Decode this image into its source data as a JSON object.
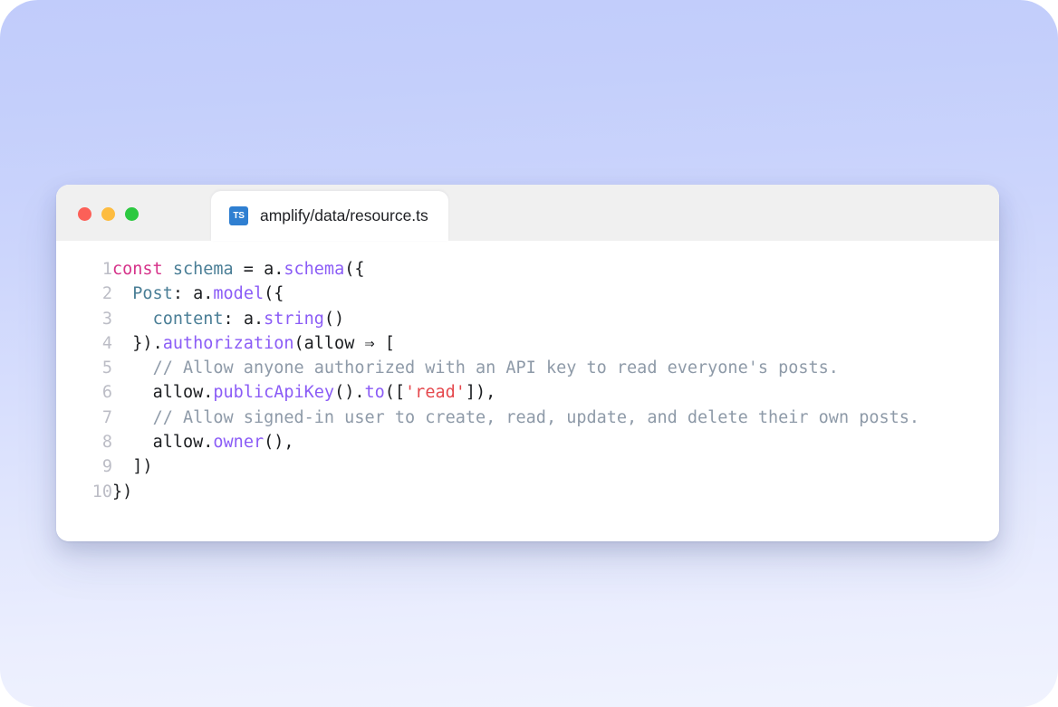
{
  "window": {
    "traffic_lights": [
      {
        "name": "close",
        "color": "#fc6058"
      },
      {
        "name": "minimize",
        "color": "#fdbc40"
      },
      {
        "name": "maximize",
        "color": "#2cc840"
      }
    ],
    "tab": {
      "icon": "typescript-file-icon",
      "icon_text": "TS",
      "label": "amplify/data/resource.ts"
    }
  },
  "editor": {
    "language": "typescript",
    "gutter_numbers": [
      "1",
      "2",
      "3",
      "4",
      "5",
      "6",
      "7",
      "8",
      "9",
      "10"
    ],
    "lines": [
      {
        "number": "1",
        "text": "const schema = a.schema({",
        "tokens": [
          {
            "t": "const",
            "c": "keyword"
          },
          {
            "t": " ",
            "c": "plain"
          },
          {
            "t": "schema",
            "c": "var"
          },
          {
            "t": " = ",
            "c": "plain"
          },
          {
            "t": "a",
            "c": "plain"
          },
          {
            "t": ".",
            "c": "punct"
          },
          {
            "t": "schema",
            "c": "method"
          },
          {
            "t": "({",
            "c": "punct"
          }
        ]
      },
      {
        "number": "2",
        "text": "  Post: a.model({",
        "tokens": [
          {
            "t": "  ",
            "c": "plain"
          },
          {
            "t": "Post",
            "c": "prop"
          },
          {
            "t": ": ",
            "c": "punct"
          },
          {
            "t": "a",
            "c": "plain"
          },
          {
            "t": ".",
            "c": "punct"
          },
          {
            "t": "model",
            "c": "method"
          },
          {
            "t": "({",
            "c": "punct"
          }
        ]
      },
      {
        "number": "3",
        "text": "    content: a.string()",
        "tokens": [
          {
            "t": "    ",
            "c": "plain"
          },
          {
            "t": "content",
            "c": "prop"
          },
          {
            "t": ": ",
            "c": "punct"
          },
          {
            "t": "a",
            "c": "plain"
          },
          {
            "t": ".",
            "c": "punct"
          },
          {
            "t": "string",
            "c": "method"
          },
          {
            "t": "()",
            "c": "punct"
          }
        ]
      },
      {
        "number": "4",
        "text": "  }).authorization(allow ⇒ [",
        "tokens": [
          {
            "t": "  })",
            "c": "punct"
          },
          {
            "t": ".",
            "c": "punct"
          },
          {
            "t": "authorization",
            "c": "method"
          },
          {
            "t": "(",
            "c": "punct"
          },
          {
            "t": "allow",
            "c": "plain"
          },
          {
            "t": " ⇒ ",
            "c": "arrow"
          },
          {
            "t": "[",
            "c": "punct"
          }
        ]
      },
      {
        "number": "5",
        "text": "    // Allow anyone authorized with an API key to read everyone's posts.",
        "tokens": [
          {
            "t": "    ",
            "c": "plain"
          },
          {
            "t": "// Allow anyone authorized with an API key to read everyone's posts.",
            "c": "comment"
          }
        ]
      },
      {
        "number": "6",
        "text": "    allow.publicApiKey().to(['read']),",
        "tokens": [
          {
            "t": "    ",
            "c": "plain"
          },
          {
            "t": "allow",
            "c": "plain"
          },
          {
            "t": ".",
            "c": "punct"
          },
          {
            "t": "publicApiKey",
            "c": "method"
          },
          {
            "t": "().",
            "c": "punct"
          },
          {
            "t": "to",
            "c": "method"
          },
          {
            "t": "([",
            "c": "punct"
          },
          {
            "t": "'read'",
            "c": "string"
          },
          {
            "t": "]),",
            "c": "punct"
          }
        ]
      },
      {
        "number": "7",
        "text": "    // Allow signed-in user to create, read, update, and delete their own posts.",
        "tokens": [
          {
            "t": "    ",
            "c": "plain"
          },
          {
            "t": "// Allow signed-in user to create, read, update, and delete their own posts.",
            "c": "comment"
          }
        ]
      },
      {
        "number": "8",
        "text": "    allow.owner(),",
        "tokens": [
          {
            "t": "    ",
            "c": "plain"
          },
          {
            "t": "allow",
            "c": "plain"
          },
          {
            "t": ".",
            "c": "punct"
          },
          {
            "t": "owner",
            "c": "method"
          },
          {
            "t": "(),",
            "c": "punct"
          }
        ]
      },
      {
        "number": "9",
        "text": "  ])",
        "tokens": [
          {
            "t": "  ])",
            "c": "punct"
          }
        ]
      },
      {
        "number": "10",
        "text": "})",
        "tokens": [
          {
            "t": "})",
            "c": "punct"
          }
        ]
      }
    ]
  },
  "colors": {
    "bg_gradient_top": "#c1ccfb",
    "bg_gradient_bottom": "#f0f3fe",
    "titlebar": "#f0f0f0",
    "tab_bg": "#ffffff",
    "ts_badge": "#2f7fd1",
    "keyword": "#d6338a",
    "variable": "#4a7e96",
    "method": "#8b5cf6",
    "string": "#e5484d",
    "comment": "#8e9aa8",
    "text": "#1c1e21",
    "gutter": "#bcbdc6"
  }
}
